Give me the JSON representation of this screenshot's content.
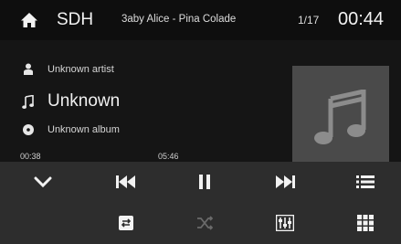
{
  "header": {
    "source": "SDH",
    "track_title": "3aby Alice - Pina Colade",
    "track_index": "1/17",
    "clock": "00:44"
  },
  "now_playing": {
    "artist": "Unknown artist",
    "title": "Unknown",
    "album": "Unknown album",
    "elapsed": "00:38",
    "total": "05:46",
    "progress_fraction": 0.11
  },
  "icons": {
    "home": "home-icon",
    "artist": "person-icon",
    "title": "music-note-icon",
    "album": "disc-icon",
    "album_art": "music-note-icon",
    "collapse": "chevron-down-icon",
    "previous": "skip-previous-icon",
    "pause": "pause-icon",
    "next": "skip-next-icon",
    "playlist": "list-icon",
    "repeat": "repeat-icon",
    "shuffle": "shuffle-icon",
    "equalizer": "equalizer-icon",
    "grid": "grid-menu-icon"
  },
  "colors": {
    "background": "#141414",
    "control_bar": "#2d2d2d",
    "icon": "#f2f2f2",
    "icon_disabled": "#6a6a6a",
    "album_art_bg": "#4a4a4a"
  }
}
